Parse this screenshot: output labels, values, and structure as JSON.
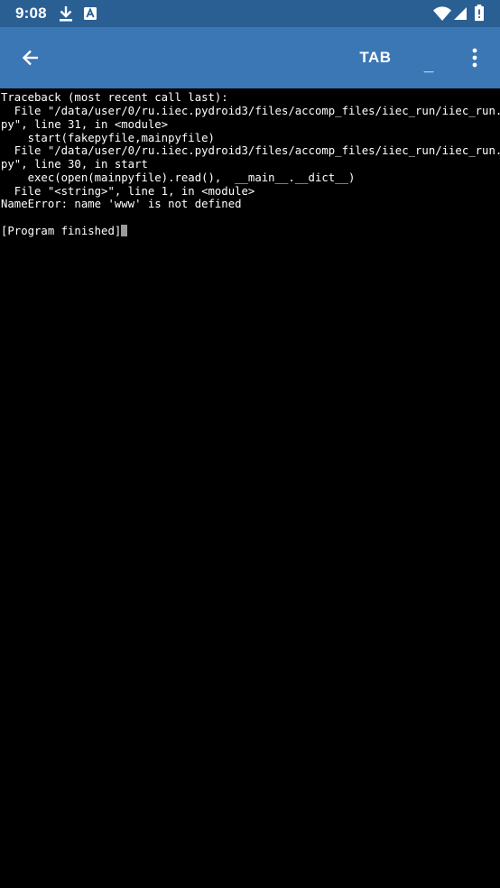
{
  "status_bar": {
    "time": "9:08",
    "icons": [
      "download-icon",
      "a-notification-icon",
      "wifi-icon",
      "signal-icon",
      "battery-icon"
    ]
  },
  "app_bar": {
    "back_icon": "arrow-back-icon",
    "tab_label": "TAB",
    "underscore_label": "_",
    "more_icon": "more-vert-icon"
  },
  "terminal": {
    "lines": [
      "Traceback (most recent call last):",
      "  File \"/data/user/0/ru.iiec.pydroid3/files/accomp_files/iiec_run/iiec_run.",
      "py\", line 31, in <module>",
      "    start(fakepyfile,mainpyfile)",
      "  File \"/data/user/0/ru.iiec.pydroid3/files/accomp_files/iiec_run/iiec_run.",
      "py\", line 30, in start",
      "    exec(open(mainpyfile).read(),  __main__.__dict__)",
      "  File \"<string>\", line 1, in <module>",
      "NameError: name 'www' is not defined",
      "",
      "[Program finished]"
    ]
  },
  "colors": {
    "status_bar_bg": "#2a5f93",
    "app_bar_bg": "#3b77b4",
    "terminal_bg": "#000000",
    "terminal_text": "#ffffff",
    "cursor": "#9a9a9a"
  }
}
